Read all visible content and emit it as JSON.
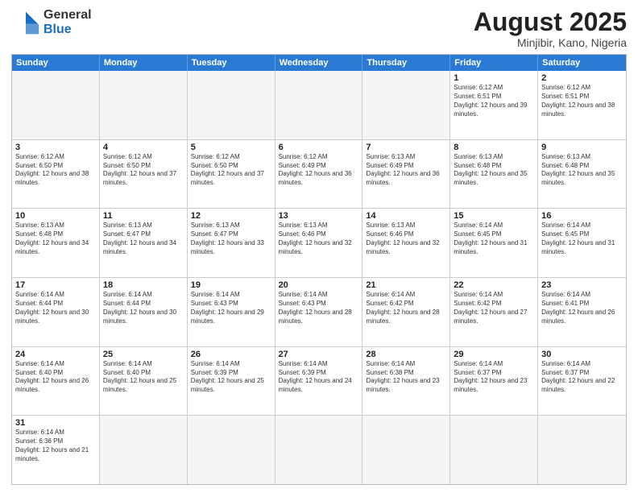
{
  "header": {
    "logo_general": "General",
    "logo_blue": "Blue",
    "title": "August 2025",
    "location": "Minjibir, Kano, Nigeria"
  },
  "calendar": {
    "days": [
      "Sunday",
      "Monday",
      "Tuesday",
      "Wednesday",
      "Thursday",
      "Friday",
      "Saturday"
    ],
    "rows": [
      [
        {
          "day": "",
          "text": ""
        },
        {
          "day": "",
          "text": ""
        },
        {
          "day": "",
          "text": ""
        },
        {
          "day": "",
          "text": ""
        },
        {
          "day": "",
          "text": ""
        },
        {
          "day": "1",
          "text": "Sunrise: 6:12 AM\nSunset: 6:51 PM\nDaylight: 12 hours and 39 minutes."
        },
        {
          "day": "2",
          "text": "Sunrise: 6:12 AM\nSunset: 6:51 PM\nDaylight: 12 hours and 38 minutes."
        }
      ],
      [
        {
          "day": "3",
          "text": "Sunrise: 6:12 AM\nSunset: 6:50 PM\nDaylight: 12 hours and 38 minutes."
        },
        {
          "day": "4",
          "text": "Sunrise: 6:12 AM\nSunset: 6:50 PM\nDaylight: 12 hours and 37 minutes."
        },
        {
          "day": "5",
          "text": "Sunrise: 6:12 AM\nSunset: 6:50 PM\nDaylight: 12 hours and 37 minutes."
        },
        {
          "day": "6",
          "text": "Sunrise: 6:12 AM\nSunset: 6:49 PM\nDaylight: 12 hours and 36 minutes."
        },
        {
          "day": "7",
          "text": "Sunrise: 6:13 AM\nSunset: 6:49 PM\nDaylight: 12 hours and 36 minutes."
        },
        {
          "day": "8",
          "text": "Sunrise: 6:13 AM\nSunset: 6:48 PM\nDaylight: 12 hours and 35 minutes."
        },
        {
          "day": "9",
          "text": "Sunrise: 6:13 AM\nSunset: 6:48 PM\nDaylight: 12 hours and 35 minutes."
        }
      ],
      [
        {
          "day": "10",
          "text": "Sunrise: 6:13 AM\nSunset: 6:48 PM\nDaylight: 12 hours and 34 minutes."
        },
        {
          "day": "11",
          "text": "Sunrise: 6:13 AM\nSunset: 6:47 PM\nDaylight: 12 hours and 34 minutes."
        },
        {
          "day": "12",
          "text": "Sunrise: 6:13 AM\nSunset: 6:47 PM\nDaylight: 12 hours and 33 minutes."
        },
        {
          "day": "13",
          "text": "Sunrise: 6:13 AM\nSunset: 6:46 PM\nDaylight: 12 hours and 32 minutes."
        },
        {
          "day": "14",
          "text": "Sunrise: 6:13 AM\nSunset: 6:46 PM\nDaylight: 12 hours and 32 minutes."
        },
        {
          "day": "15",
          "text": "Sunrise: 6:14 AM\nSunset: 6:45 PM\nDaylight: 12 hours and 31 minutes."
        },
        {
          "day": "16",
          "text": "Sunrise: 6:14 AM\nSunset: 6:45 PM\nDaylight: 12 hours and 31 minutes."
        }
      ],
      [
        {
          "day": "17",
          "text": "Sunrise: 6:14 AM\nSunset: 6:44 PM\nDaylight: 12 hours and 30 minutes."
        },
        {
          "day": "18",
          "text": "Sunrise: 6:14 AM\nSunset: 6:44 PM\nDaylight: 12 hours and 30 minutes."
        },
        {
          "day": "19",
          "text": "Sunrise: 6:14 AM\nSunset: 6:43 PM\nDaylight: 12 hours and 29 minutes."
        },
        {
          "day": "20",
          "text": "Sunrise: 6:14 AM\nSunset: 6:43 PM\nDaylight: 12 hours and 28 minutes."
        },
        {
          "day": "21",
          "text": "Sunrise: 6:14 AM\nSunset: 6:42 PM\nDaylight: 12 hours and 28 minutes."
        },
        {
          "day": "22",
          "text": "Sunrise: 6:14 AM\nSunset: 6:42 PM\nDaylight: 12 hours and 27 minutes."
        },
        {
          "day": "23",
          "text": "Sunrise: 6:14 AM\nSunset: 6:41 PM\nDaylight: 12 hours and 26 minutes."
        }
      ],
      [
        {
          "day": "24",
          "text": "Sunrise: 6:14 AM\nSunset: 6:40 PM\nDaylight: 12 hours and 26 minutes."
        },
        {
          "day": "25",
          "text": "Sunrise: 6:14 AM\nSunset: 6:40 PM\nDaylight: 12 hours and 25 minutes."
        },
        {
          "day": "26",
          "text": "Sunrise: 6:14 AM\nSunset: 6:39 PM\nDaylight: 12 hours and 25 minutes."
        },
        {
          "day": "27",
          "text": "Sunrise: 6:14 AM\nSunset: 6:39 PM\nDaylight: 12 hours and 24 minutes."
        },
        {
          "day": "28",
          "text": "Sunrise: 6:14 AM\nSunset: 6:38 PM\nDaylight: 12 hours and 23 minutes."
        },
        {
          "day": "29",
          "text": "Sunrise: 6:14 AM\nSunset: 6:37 PM\nDaylight: 12 hours and 23 minutes."
        },
        {
          "day": "30",
          "text": "Sunrise: 6:14 AM\nSunset: 6:37 PM\nDaylight: 12 hours and 22 minutes."
        }
      ],
      [
        {
          "day": "31",
          "text": "Sunrise: 6:14 AM\nSunset: 6:36 PM\nDaylight: 12 hours and 21 minutes."
        },
        {
          "day": "",
          "text": ""
        },
        {
          "day": "",
          "text": ""
        },
        {
          "day": "",
          "text": ""
        },
        {
          "day": "",
          "text": ""
        },
        {
          "day": "",
          "text": ""
        },
        {
          "day": "",
          "text": ""
        }
      ]
    ]
  }
}
